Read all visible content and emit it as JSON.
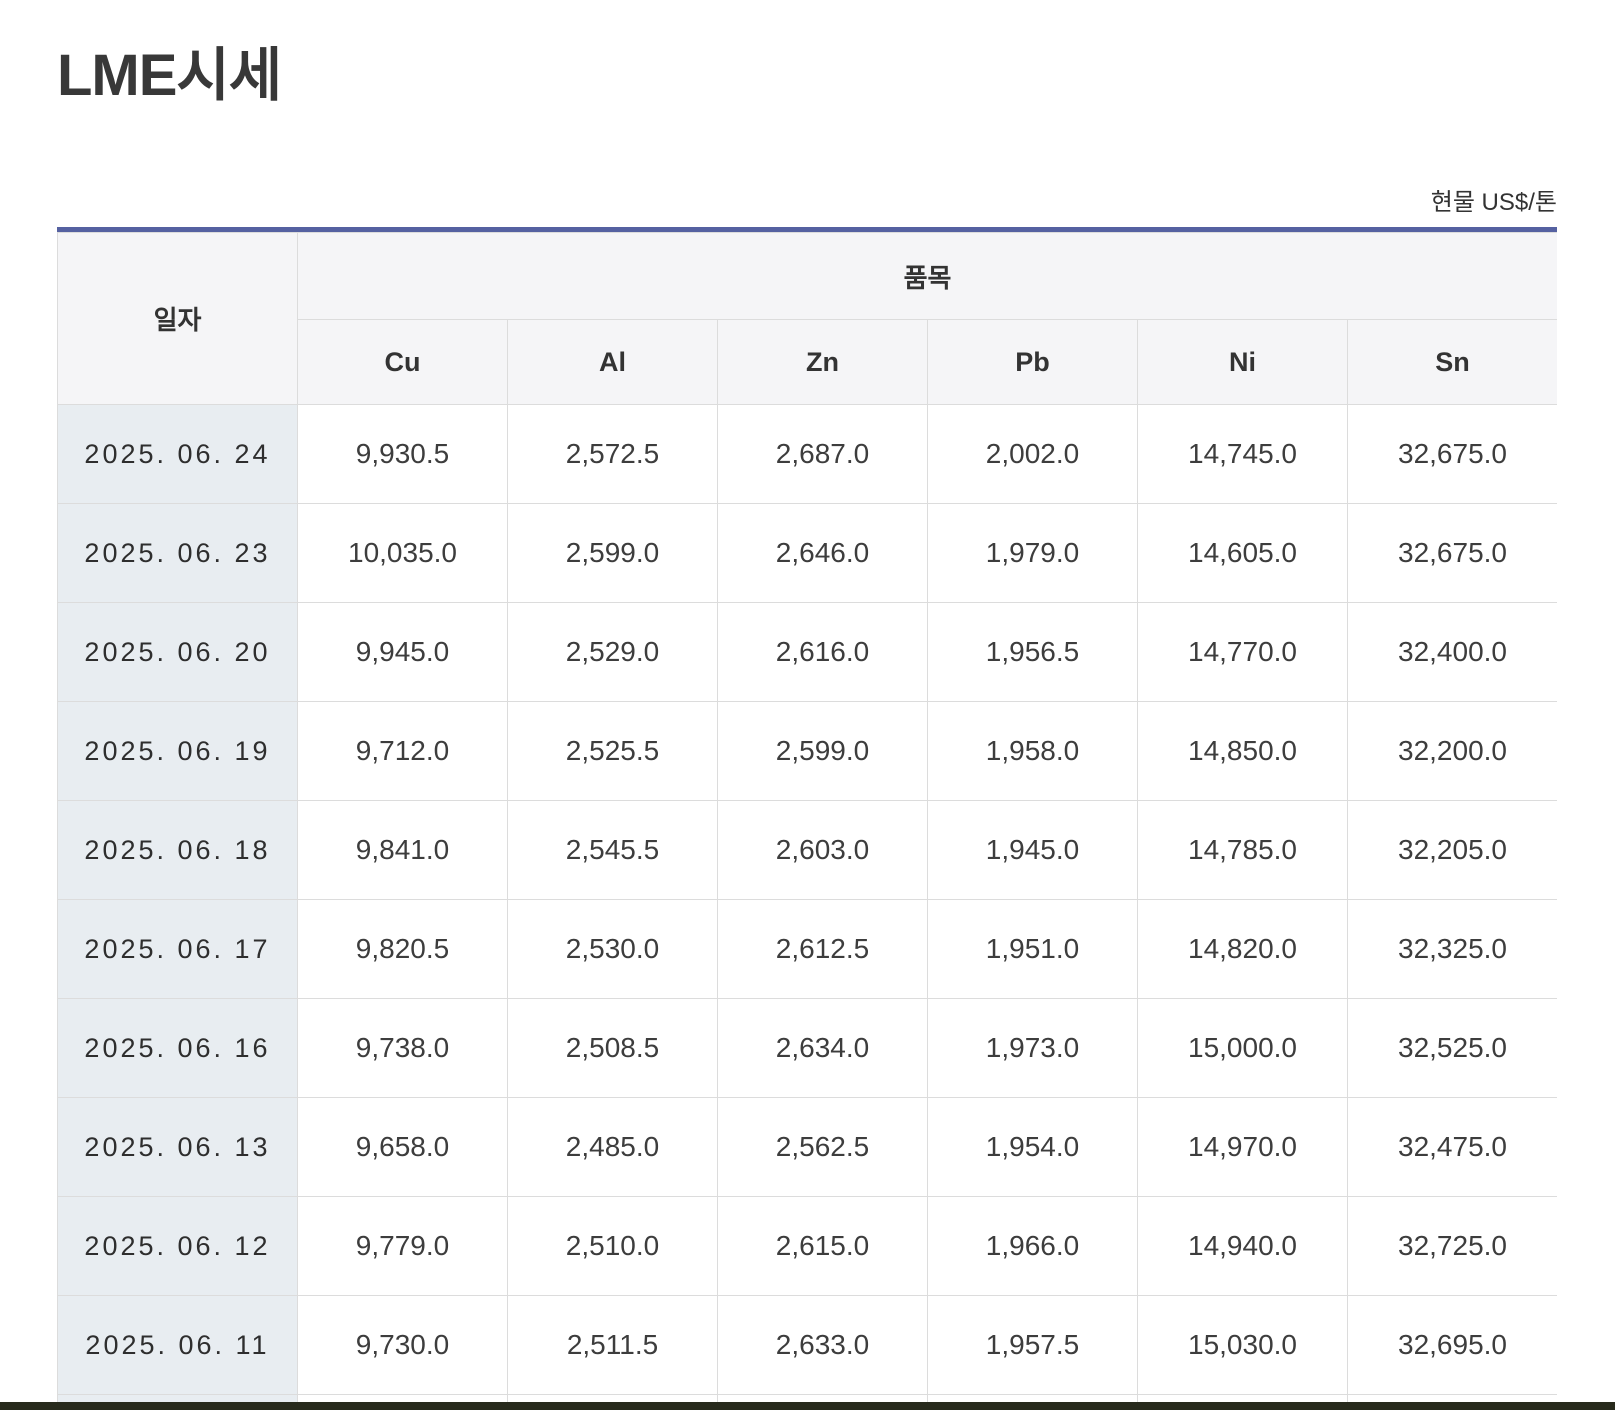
{
  "page": {
    "title": "LME시세",
    "unit_label": "현물 US$/톤"
  },
  "table": {
    "date_header": "일자",
    "group_header": "품목",
    "columns": [
      "Cu",
      "Al",
      "Zn",
      "Pb",
      "Ni",
      "Sn"
    ],
    "rows": [
      {
        "date": "2025. 06. 24",
        "values": [
          "9,930.5",
          "2,572.5",
          "2,687.0",
          "2,002.0",
          "14,745.0",
          "32,675.0"
        ]
      },
      {
        "date": "2025. 06. 23",
        "values": [
          "10,035.0",
          "2,599.0",
          "2,646.0",
          "1,979.0",
          "14,605.0",
          "32,675.0"
        ]
      },
      {
        "date": "2025. 06. 20",
        "values": [
          "9,945.0",
          "2,529.0",
          "2,616.0",
          "1,956.5",
          "14,770.0",
          "32,400.0"
        ]
      },
      {
        "date": "2025. 06. 19",
        "values": [
          "9,712.0",
          "2,525.5",
          "2,599.0",
          "1,958.0",
          "14,850.0",
          "32,200.0"
        ]
      },
      {
        "date": "2025. 06. 18",
        "values": [
          "9,841.0",
          "2,545.5",
          "2,603.0",
          "1,945.0",
          "14,785.0",
          "32,205.0"
        ]
      },
      {
        "date": "2025. 06. 17",
        "values": [
          "9,820.5",
          "2,530.0",
          "2,612.5",
          "1,951.0",
          "14,820.0",
          "32,325.0"
        ]
      },
      {
        "date": "2025. 06. 16",
        "values": [
          "9,738.0",
          "2,508.5",
          "2,634.0",
          "1,973.0",
          "15,000.0",
          "32,525.0"
        ]
      },
      {
        "date": "2025. 06. 13",
        "values": [
          "9,658.0",
          "2,485.0",
          "2,562.5",
          "1,954.0",
          "14,970.0",
          "32,475.0"
        ]
      },
      {
        "date": "2025. 06. 12",
        "values": [
          "9,779.0",
          "2,510.0",
          "2,615.0",
          "1,966.0",
          "14,940.0",
          "32,725.0"
        ]
      },
      {
        "date": "2025. 06. 11",
        "values": [
          "9,730.0",
          "2,511.5",
          "2,633.0",
          "1,957.5",
          "15,030.0",
          "32,695.0"
        ]
      }
    ]
  },
  "colors": {
    "accent_line": "#5561a1",
    "header_bg": "#f5f5f7",
    "date_cell_bg": "#e8edf1",
    "cell_border": "#dcdcdc",
    "footer_bar": "#272a1c"
  }
}
